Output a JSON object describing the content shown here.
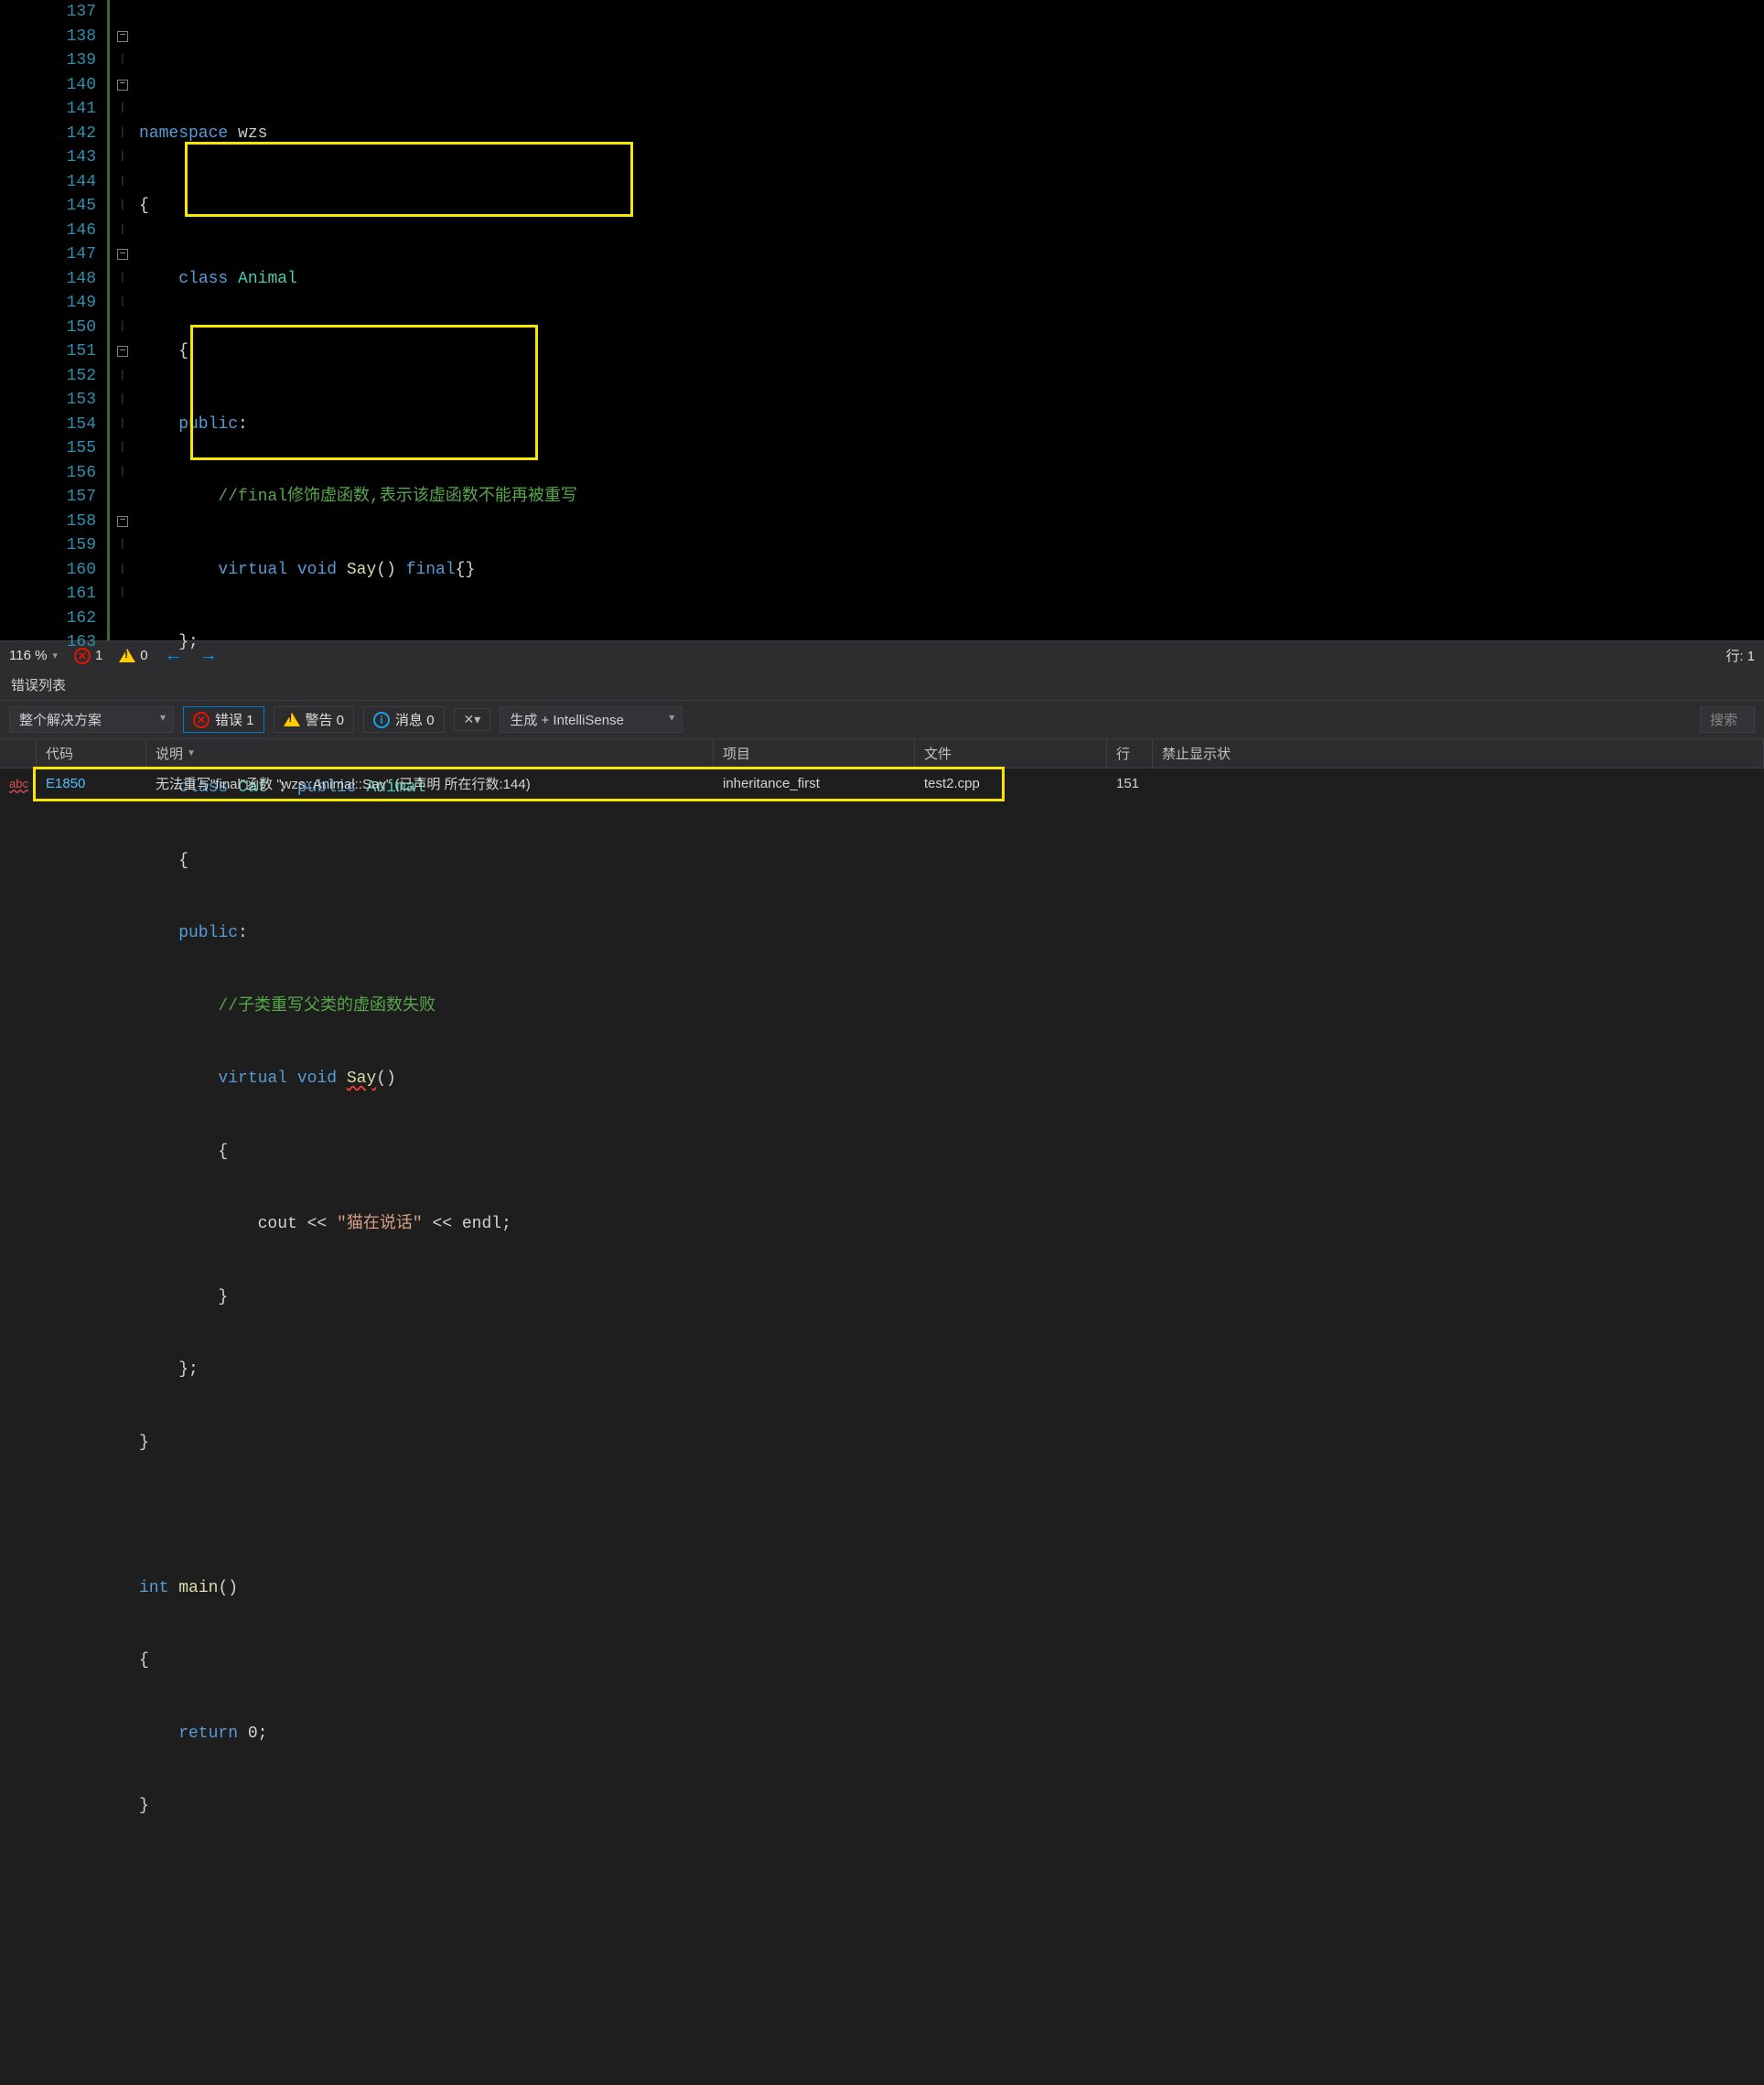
{
  "editor": {
    "lines_start": 137,
    "gutter": [
      "137",
      "138",
      "139",
      "140",
      "141",
      "142",
      "143",
      "144",
      "145",
      "146",
      "147",
      "148",
      "149",
      "150",
      "151",
      "152",
      "153",
      "154",
      "155",
      "156",
      "157",
      "158",
      "159",
      "160",
      "161",
      "162",
      "163"
    ],
    "fold": [
      "",
      "−",
      "",
      "−",
      "",
      "",
      "",
      "",
      "",
      "",
      "−",
      "",
      "",
      "",
      "−",
      "",
      "",
      "",
      "",
      "",
      "",
      "−",
      "",
      "",
      "",
      "",
      ""
    ],
    "code": {
      "l138_kw": "namespace",
      "l138_ns": " wzs",
      "l139": "{",
      "l140_kw": "class",
      "l140_typ": " Animal",
      "l141": "    {",
      "l142_kw": "    public",
      "l142_colon": ":",
      "l143_cm": "        //final修饰虚函数,表示该虚函数不能再被重写",
      "l144_kw1": "        virtual ",
      "l144_kw2": "void ",
      "l144_fn": "Say",
      "l144_p": "() ",
      "l144_kw3": "final",
      "l144_brace": "{}",
      "l145": "    };",
      "l146": "",
      "l147_kw": "    class",
      "l147_typ1": " Cat",
      "l147_colon": " : ",
      "l147_kw2": "public ",
      "l147_typ2": "Animal",
      "l148": "    {",
      "l149_kw": "    public",
      "l149_colon": ":",
      "l150_cm": "        //子类重写父类的虚函数失败",
      "l151_kw1": "        virtual ",
      "l151_kw2": "void ",
      "l151_fn": "Say",
      "l151_p": "()",
      "l152": "        {",
      "l153_a": "            cout << ",
      "l153_str": "\"猫在说话\"",
      "l153_b": " << endl;",
      "l154": "        }",
      "l155": "    };",
      "l156": "}",
      "l157": "",
      "l158_kw": "int ",
      "l158_fn": "main",
      "l158_p": "()",
      "l159": "{",
      "l160_kw": "    return ",
      "l160_v": "0;",
      "l161": "}",
      "l162": "",
      "l163": ""
    }
  },
  "statusbar": {
    "zoom": "116 %",
    "err_count": "1",
    "warn_count": "0",
    "line_info": "行: 1"
  },
  "errorlist": {
    "title": "错误列表",
    "scope": "整个解决方案",
    "err_pill": "错误 1",
    "warn_pill": "警告 0",
    "msg_pill": "消息 0",
    "build_combo": "生成 + IntelliSense",
    "search_placeholder": "搜索",
    "headers": {
      "code": "代码",
      "desc": "说明",
      "proj": "项目",
      "file": "文件",
      "line": "行",
      "suppress": "禁止显示状"
    },
    "row": {
      "code": "E1850",
      "desc": "无法重写\"final\"函数 \"wzs::Animal::Say\" (已声明 所在行数:144)",
      "proj": "inheritance_first",
      "file": "test2.cpp",
      "line": "151"
    }
  }
}
